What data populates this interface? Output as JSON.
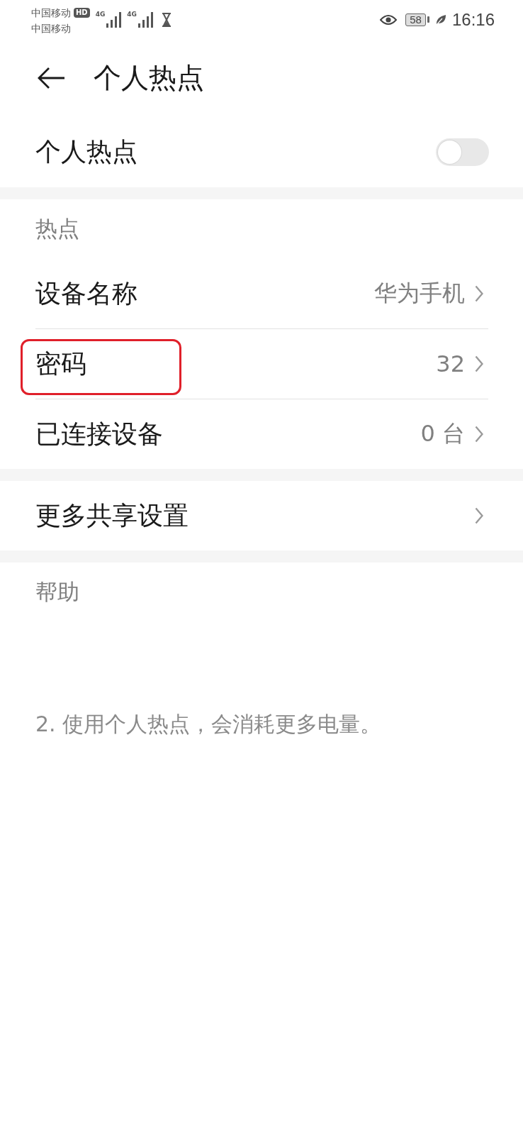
{
  "status_bar": {
    "carriers": [
      {
        "name": "中国移动",
        "badge": "HD"
      },
      {
        "name": "中国移动"
      }
    ],
    "networks": [
      {
        "label": "4G"
      },
      {
        "label": "4G"
      }
    ],
    "battery": "58",
    "time": "16:16"
  },
  "header": {
    "title": "个人热点"
  },
  "hotspot_toggle": {
    "label": "个人热点",
    "on": false
  },
  "sections": [
    {
      "header": "热点",
      "rows": [
        {
          "label": "设备名称",
          "value": "华为手机",
          "annotated": false
        },
        {
          "label": "密码",
          "value": "32",
          "annotated": true
        },
        {
          "label": "已连接设备",
          "value": "0 台",
          "annotated": false
        }
      ]
    },
    {
      "rows": [
        {
          "label": "更多共享设置",
          "annotated": false
        }
      ]
    },
    {
      "header": "帮助",
      "paragraphs": [
        "2. 使用个人热点，会消耗更多电量。"
      ]
    }
  ]
}
